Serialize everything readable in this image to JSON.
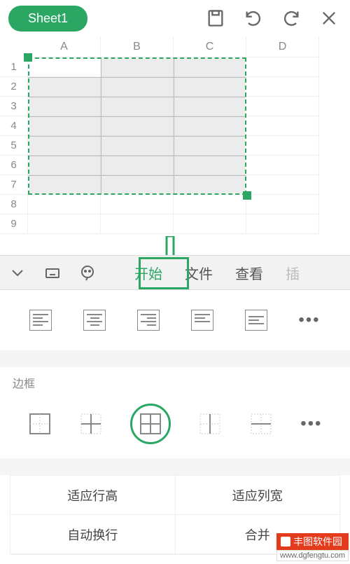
{
  "colors": {
    "accent": "#2ba763"
  },
  "topbar": {
    "sheet_label": "Sheet1",
    "icons": {
      "save": "save-icon",
      "undo": "undo-icon",
      "redo": "redo-icon",
      "close": "close-icon"
    }
  },
  "sheet": {
    "columns": [
      "A",
      "B",
      "C",
      "D"
    ],
    "rows": [
      "1",
      "2",
      "3",
      "4",
      "5",
      "6",
      "7",
      "8",
      "9"
    ],
    "selection": {
      "from": "A1",
      "to": "C7"
    }
  },
  "tabbar": {
    "collapse_icon": "chevron-down-icon",
    "keyboard_icon": "keyboard-icon",
    "assistant_icon": "assistant-icon",
    "tabs": [
      {
        "id": "start",
        "label": "开始",
        "active": true
      },
      {
        "id": "file",
        "label": "文件",
        "active": false
      },
      {
        "id": "view",
        "label": "查看",
        "active": false
      },
      {
        "id": "more",
        "label": "插",
        "active": false
      }
    ]
  },
  "align": {
    "buttons": [
      "align-left",
      "align-center",
      "align-right",
      "align-top",
      "align-middle"
    ],
    "more": "•••"
  },
  "border": {
    "label": "边框",
    "buttons": [
      "border-outer",
      "border-inner",
      "border-all",
      "border-vertical",
      "border-horizontal"
    ],
    "selected_index": 2,
    "more": "•••"
  },
  "fit": {
    "row_height": "适应行高",
    "col_width": "适应列宽",
    "wrap": "自动换行",
    "merge": "合并"
  },
  "watermark": {
    "title": "丰图软件园",
    "url": "www.dgfengtu.com"
  }
}
